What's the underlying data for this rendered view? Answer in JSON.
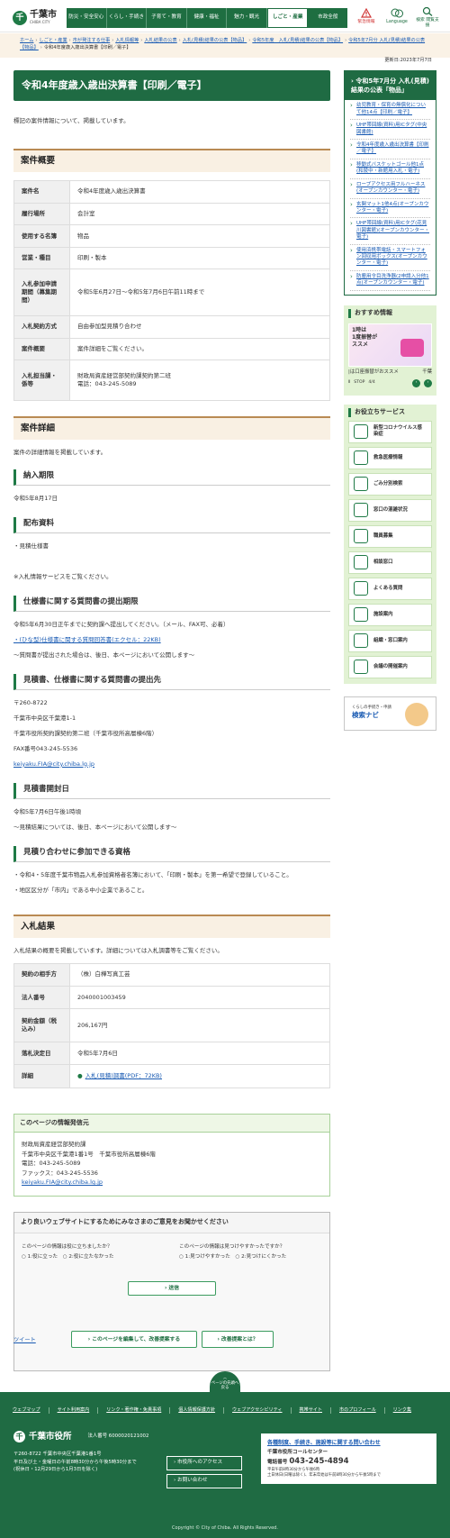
{
  "header": {
    "logo_text": "千葉市",
    "logo_sub": "CHIBA CITY",
    "nav": [
      "防災・安全安心",
      "くらし・手続き",
      "子育て・教育",
      "健康・福祉",
      "魅力・観光",
      "しごと・産業",
      "市政全般"
    ],
    "active_nav": "しごと・産業",
    "icons": [
      {
        "name": "emergency",
        "label": "緊急情報"
      },
      {
        "name": "language",
        "label": "Language"
      },
      {
        "name": "search",
        "label": "検索 閲覧支援"
      }
    ]
  },
  "breadcrumb": [
    "ホーム",
    "しごと・産業",
    "市が発注する仕事",
    "入札情報等",
    "入札結果の公表",
    "入札(見積)結果の公表【物品】",
    "令和5年度　入札(見積)結果の公表【物品】",
    "令和5年7月分 入札(見積)結果の公表【物品】",
    "令和4年度歳入歳出決算書【印刷／電子】"
  ],
  "updated": "更新日:2023年7月7日",
  "title": "令和4年度歳入歳出決算書【印刷／電子】",
  "intro": "標記の案件情報について、掲載しています。",
  "overview": {
    "heading": "案件概要",
    "rows": [
      {
        "label": "案件名",
        "value": [
          "令和4年度歳入歳出決算書"
        ]
      },
      {
        "label": "履行場所",
        "value": [
          "会計室"
        ]
      },
      {
        "label": "使用する名簿",
        "value": [
          "物品"
        ]
      },
      {
        "label": "営業・種目",
        "value": [
          "印刷・製本"
        ]
      },
      {
        "label": "入札参加申請期間（募集期間）",
        "value": [
          "令和5年6月27日～令和5年7月6日午前11時まで"
        ]
      },
      {
        "label": "入札契約方式",
        "value": [
          "自由参加型見積り合わせ"
        ]
      },
      {
        "label": "案件概要",
        "value": [
          "案件詳細をご覧ください。"
        ]
      },
      {
        "label": "入札担当課・係等",
        "value": [
          "財政局資産経営部契約課契約第二班",
          "電話：043-245-5089"
        ]
      }
    ]
  },
  "detail": {
    "heading": "案件詳細",
    "intro": "案件の詳細情報を掲載しています。",
    "sections": [
      {
        "title": "納入期限",
        "lines": [
          "令和5年8月17日"
        ]
      },
      {
        "title": "配布資料",
        "lines": [
          "・見積仕様書",
          "",
          "※入札情報サービスをご覧ください。"
        ]
      },
      {
        "title": "仕様書に関する質問書の提出期限",
        "lines": [
          "令和5年6月30日正午までに契約課へ提出してください。（メール、FAX可、必着）",
          "・(ひな型)仕様書に関する質問回答書(エクセル：22KB)",
          "～質問書が提出された場合は、後日、本ページにおいて公開します～"
        ],
        "link_index": 1
      },
      {
        "title": "見積書、仕様書に関する質問書の提出先",
        "lines": [
          "〒260-8722",
          "千葉市中央区千葉港1-1",
          "千葉市役所契約課契約第二班（千葉市役所高層棟6階）",
          "FAX番号043-245-5536",
          "keiyaku.FIA@city.chiba.lg.jp"
        ],
        "link_index": 4
      },
      {
        "title": "見積書開封日",
        "lines": [
          "令和5年7月6日午後1時頃",
          "～見積結果については、後日、本ページにおいて公開します～"
        ]
      },
      {
        "title": "見積り合わせに参加できる資格",
        "lines": [
          "・令和4・5年度千葉市物品入札参加資格者名簿において、「印刷・製本」を第一希望で登録していること。",
          "・地区区分が「市内」である中小企業であること。"
        ]
      }
    ]
  },
  "result": {
    "heading": "入札結果",
    "intro": "入札結果の概要を掲載しています。詳細については入札調書等をご覧ください。",
    "rows": [
      {
        "label": "契約の相手方",
        "value": "（株）白樺写真工芸"
      },
      {
        "label": "法人番号",
        "value": "2040001003459"
      },
      {
        "label": "契約金額（税込み）",
        "value": "206,167円"
      },
      {
        "label": "落札決定日",
        "value": "令和5年7月6日"
      },
      {
        "label": "詳細",
        "value": "入札(見積)調書(PDF：72KB)"
      }
    ]
  },
  "contact": {
    "heading": "このページの情報発信元",
    "lines": [
      "財政局資産経営部契約課",
      "千葉市中央区千葉港1番1号　千葉市役所高層棟6階",
      "電話：043-245-5089",
      "ファックス：043-245-5536",
      "keiyaku.FIA@city.chiba.lg.jp"
    ]
  },
  "survey": {
    "heading": "より良いウェブサイトにするためにみなさまのご意見をお聞かせください",
    "q1": "このページの情報は役に立ちましたか？",
    "q1_opts": [
      "1:役に立った",
      "2:役に立たなかった"
    ],
    "q2": "このページの情報は見つけやすかったですか？",
    "q2_opts": [
      "1:見つけやすかった",
      "2:見つけにくかった"
    ],
    "submit": "送信",
    "edit_link": "このページを編集して、改善提案する",
    "about_link": "改善提案とは？"
  },
  "tweet": "ツイート",
  "sidebar": {
    "heading": "令和5年7月分 入札(見積)結果の公表「物品」",
    "items": [
      "幼児教育・保育の無償化について他14点【印刷／電子】",
      "UHF帯回線(資料)用ICタグ(中央図書館)",
      "令和4年度歳入歳出決算書【印刷／電子】",
      "移動式バスケットゴール他1点(和陵中・新館用入札・電子)",
      "ロープアクセス用フルハーネス(オープンカウンター・電子)",
      "玄関マット1他4点(オープンカウンター・電子)",
      "UHF帯回線(資料)用ICタグ(花見川図書館)(オープンカウンター・電子)",
      "使用済携帯電話・スマートフォン回収用ボックス(オープンカウンター・電子)",
      "防塵用令目洗浄器(2申請入分他1点(オープンカウンター・電子)"
    ],
    "reco_heading": "おすすめ情報",
    "reco_banner": "1時は\n1度振替が\nススメ",
    "reco_caption": "|は口座振替がおススメ",
    "reco_caption2": "千葉",
    "reco_stop": "STOP",
    "reco_count": "4/4",
    "useful_heading": "お役立ちサービス",
    "useful": [
      {
        "icon": "virus-icon",
        "label": "新型コロナウイルス感染症"
      },
      {
        "icon": "ambulance-icon",
        "label": "救急医療情報"
      },
      {
        "icon": "trash-icon",
        "label": "ごみ分別検索"
      },
      {
        "icon": "window-icon",
        "label": "窓口の混雑状況"
      },
      {
        "icon": "staff-icon",
        "label": "職員募集"
      },
      {
        "icon": "consult-icon",
        "label": "相談窓口"
      },
      {
        "icon": "faq-icon",
        "label": "よくある質問"
      },
      {
        "icon": "facility-icon",
        "label": "施設案内"
      },
      {
        "icon": "org-icon",
        "label": "組織・窓口案内"
      },
      {
        "icon": "calendar-icon",
        "label": "会議の開催案内"
      }
    ],
    "navi_small": "くらしの手続き・申請",
    "navi_title": "検索ナビ"
  },
  "pagetop": "ページの先頭へ戻る",
  "footer": {
    "links": [
      "ウェブマップ",
      "サイト利用案内",
      "リンク・著作権・免責事項",
      "個人情報保護方針",
      "ウェブアクセシビリティ",
      "携帯サイト",
      "市のプロフィール",
      "リンク集"
    ],
    "brand": "千葉市役所",
    "corp_no": "法人番号 6000020121002",
    "address": [
      "〒260-8722 千葉市中央区千葉港1番1号",
      "平日及び土・金曜日の午前8時30分から午後5時30分まで",
      "(祝休日・12月29日から1月3日を除く)"
    ],
    "access": "市役所へのアクセス",
    "inquiry": "お問い合わせ",
    "call_link": "各種制度、手続き、施設等に関する問い合わせ",
    "call_name": "千葉市役所コールセンター",
    "call_tel_label": "電話番号",
    "call_tel": "043-245-4894",
    "call_hours": [
      "平日午前8時30分から午後6時",
      "土日休日(日曜は除く)、年末年始は午前8時30分から午後5時まで"
    ],
    "copyright": "Copyright © City of Chiba. All Rights Reserved."
  }
}
